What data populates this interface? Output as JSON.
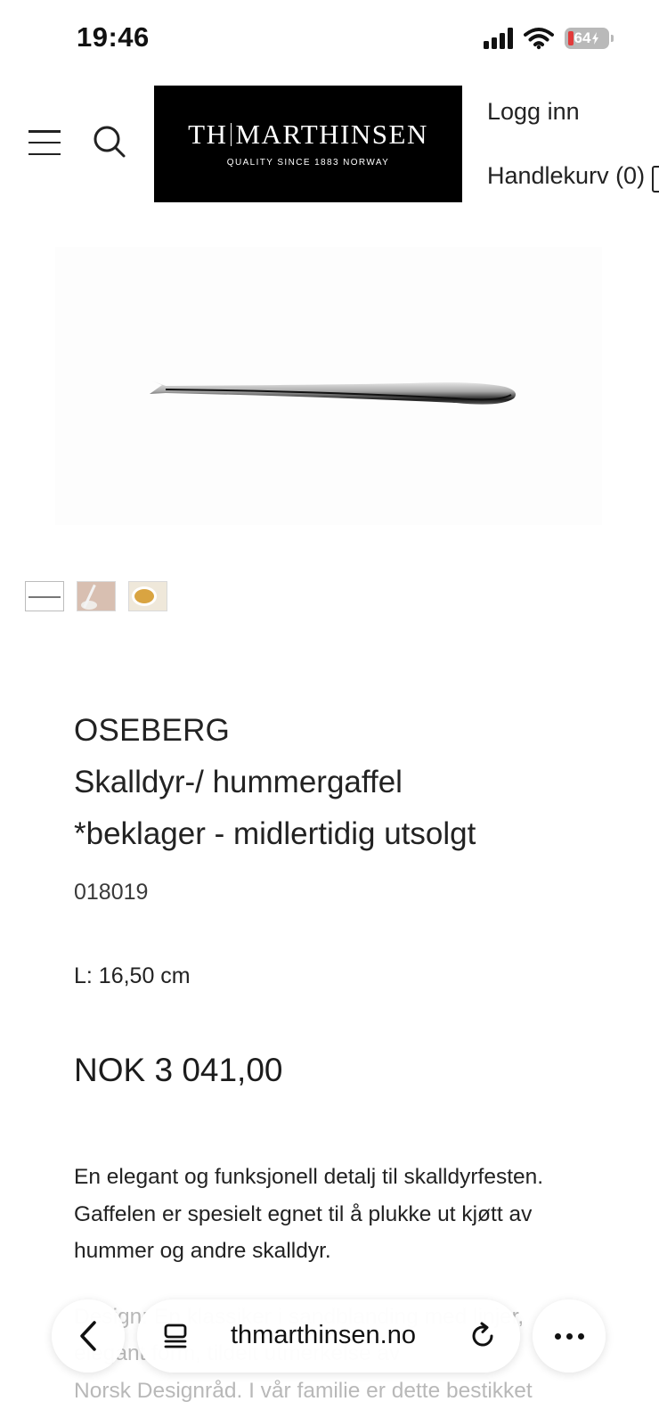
{
  "status_bar": {
    "time": "19:46",
    "battery": "64",
    "icons": [
      "signal-icon",
      "wifi-icon",
      "battery-charging-icon"
    ]
  },
  "header": {
    "logo_main_left": "TH",
    "logo_main_right": "MARTHINSEN",
    "logo_sub": "QUALITY SINCE 1883   NORWAY",
    "login": "Logg inn",
    "cart": "Handlekurv (0)",
    "icons": [
      "menu-icon",
      "search-icon",
      "cart-icon"
    ]
  },
  "product": {
    "brand": "OSEBERG",
    "name": "Skalldyr-/ hummergaffel",
    "availability_note": "*beklager - midlertidig utsolgt",
    "sku": "018019",
    "length": "L: 16,50 cm",
    "price": "NOK 3 041,00",
    "description_lines": [
      "En elegant og funksjonell detalj til skalldyrfesten.",
      "Gaffelen er spesielt egnet til å plukke ut kjøtt av",
      "hummer og andre skalldyr."
    ],
    "description_more_lines": [
      "Design: En klassiker i sandblanding med linjer,",
      "elegant form, tildelt utmerkelse av",
      "Norsk Designråd. I vår familie er dette bestikket"
    ],
    "thumbnails": [
      "product-only",
      "table-setting",
      "plated-dish"
    ]
  },
  "browser": {
    "url": "thmarthinsen.no",
    "icons": [
      "back-icon",
      "tabs-icon",
      "reload-icon",
      "more-icon"
    ]
  },
  "colors": {
    "logo_background": "#000000",
    "text": "#222222",
    "battery_low": "#e23b3b"
  }
}
